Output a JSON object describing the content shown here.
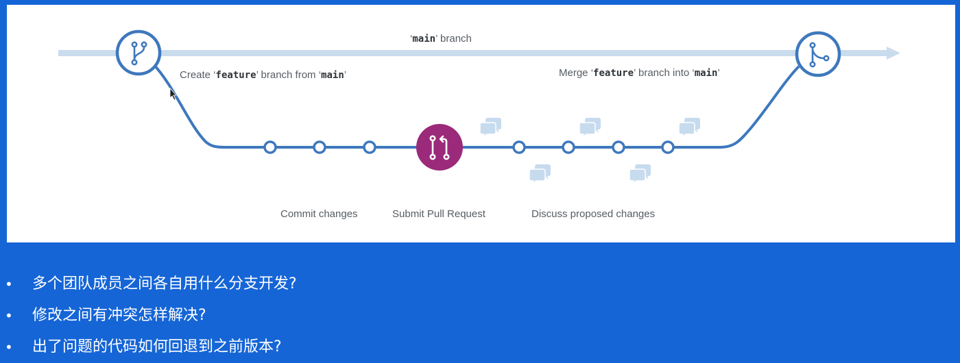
{
  "diagram": {
    "main_branch_label": {
      "quote_open": "‘",
      "code": "main",
      "quote_close": "’",
      "suffix": " branch"
    },
    "create_label": {
      "prefix": "Create ",
      "code1": "feature",
      "middle": " branch from ",
      "code2": "main",
      "quote_open": "‘",
      "quote_close": "’"
    },
    "merge_label": {
      "prefix": "Merge ",
      "code1": "feature",
      "middle": " branch into ",
      "code2": "main",
      "quote_open": "‘",
      "quote_close": "’"
    },
    "commit_label": "Commit changes",
    "pr_label": "Submit Pull Request",
    "discuss_label": "Discuss proposed changes",
    "icons": {
      "branch": "git-branch-icon",
      "merge": "git-merge-icon",
      "pull_request": "pull-request-icon",
      "comment": "comment-bubbles-icon"
    },
    "colors": {
      "line": "#3e78bd",
      "main_arrow": "#c9dcee",
      "pull_request": "#9b2a7a",
      "comment": "#c7dbee"
    }
  },
  "bullets": [
    {
      "dot": "•",
      "text": "多个团队成员之间各自用什么分支开发?"
    },
    {
      "dot": "•",
      "text": "修改之间有冲突怎样解决?"
    },
    {
      "dot": "•",
      "text": "出了问题的代码如何回退到之前版本?"
    }
  ],
  "colors": {
    "background": "#1565d6",
    "panel": "#ffffff"
  }
}
